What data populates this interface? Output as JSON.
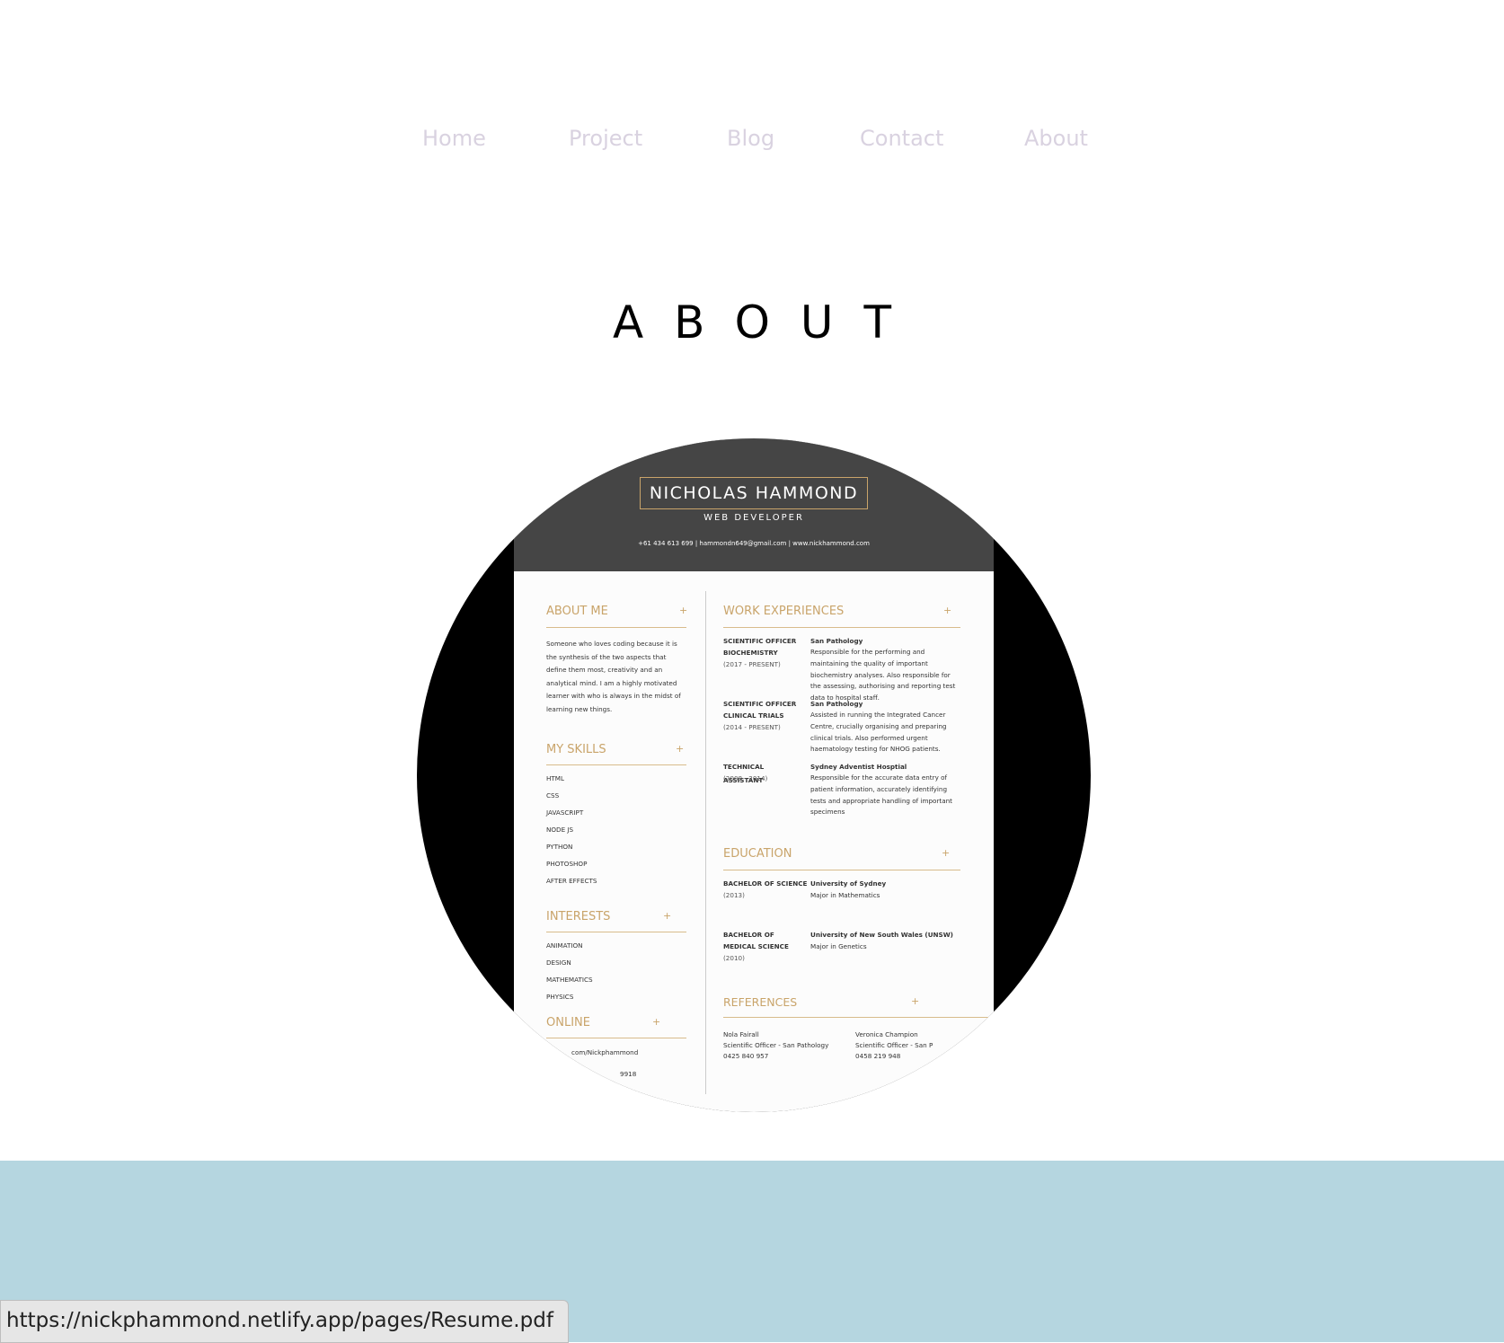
{
  "nav": {
    "items": [
      "Home",
      "Project",
      "Blog",
      "Contact",
      "About"
    ]
  },
  "page": {
    "title": "ABOUT"
  },
  "resume": {
    "name": "NICHOLAS HAMMOND",
    "role": "WEB DEVELOPER",
    "contact": "+61 434 613 699  |  hammondn649@gmail.com  |  www.nickhammond.com",
    "about_heading": "ABOUT ME",
    "about_text": "Someone who loves coding because it is the synthesis of the two aspects that define them most, creativity and an analytical mind. I am a highly motivated learner with who is always in the midst of learning new things.",
    "skills_heading": "MY SKILLS",
    "skills": [
      "HTML",
      "CSS",
      "JAVASCRIPT",
      "NODE JS",
      "PYTHON",
      "PHOTOSHOP",
      "AFTER EFFECTS"
    ],
    "interests_heading": "INTERESTS",
    "interests": [
      "ANIMATION",
      "DESIGN",
      "MATHEMATICS",
      "PHYSICS"
    ],
    "online_heading": "ONLINE",
    "online_items": [
      "com/Nickphammond",
      "9918"
    ],
    "work_heading": "WORK EXPERIENCES",
    "work": [
      {
        "title": "SCIENTIFIC OFFICER",
        "title2": "BIOCHEMISTRY",
        "dates": "(2017 - PRESENT)",
        "org": "San Pathology",
        "desc": "Responsible for the performing and maintaining the quality of important biochemistry analyses. Also responsible for the assessing, authorising and reporting test data to hospital staff."
      },
      {
        "title": "SCIENTIFIC OFFICER",
        "title2": "CLINICAL TRIALS",
        "dates": "(2014 - PRESENT)",
        "org": "San Pathology",
        "desc": "Assisted in running the Integrated Cancer Centre, crucially organising and preparing clinical trials. Also performed urgent haematology testing for NHOG patients."
      },
      {
        "title": "TECHNICAL ASSISTANT",
        "title2": "",
        "dates": "(2008 - 2014)",
        "org": "Sydney Adventist Hosptial",
        "desc": "Responsible for the accurate data entry of patient information, accurately identifying tests and appropriate handling of important specimens"
      }
    ],
    "education_heading": "EDUCATION",
    "education": [
      {
        "degree": "BACHELOR OF SCIENCE",
        "degree2": "",
        "year": "(2013)",
        "school": "University of Sydney",
        "major": "Major in Mathematics"
      },
      {
        "degree": "BACHELOR OF",
        "degree2": "MEDICAL SCIENCE",
        "year": "(2010)",
        "school": "University of New South Wales (UNSW)",
        "major": "Major in Genetics"
      }
    ],
    "references_heading": "REFERENCES",
    "references": [
      {
        "name": "Nola Fairall",
        "position": "Scientific Officer - San Pathology",
        "phone": "0425 840 957"
      },
      {
        "name": "Veronica Champion",
        "position": "Scientific Officer - San P",
        "phone": "0458 219 948"
      }
    ],
    "plus": "+"
  },
  "status_bar": {
    "url": "https://nickphammond.netlify.app/pages/Resume.pdf"
  },
  "colors": {
    "nav_text": "#d9d2e0",
    "accent_gold": "#c9a46a",
    "footer_band": "#b5d6e0"
  }
}
